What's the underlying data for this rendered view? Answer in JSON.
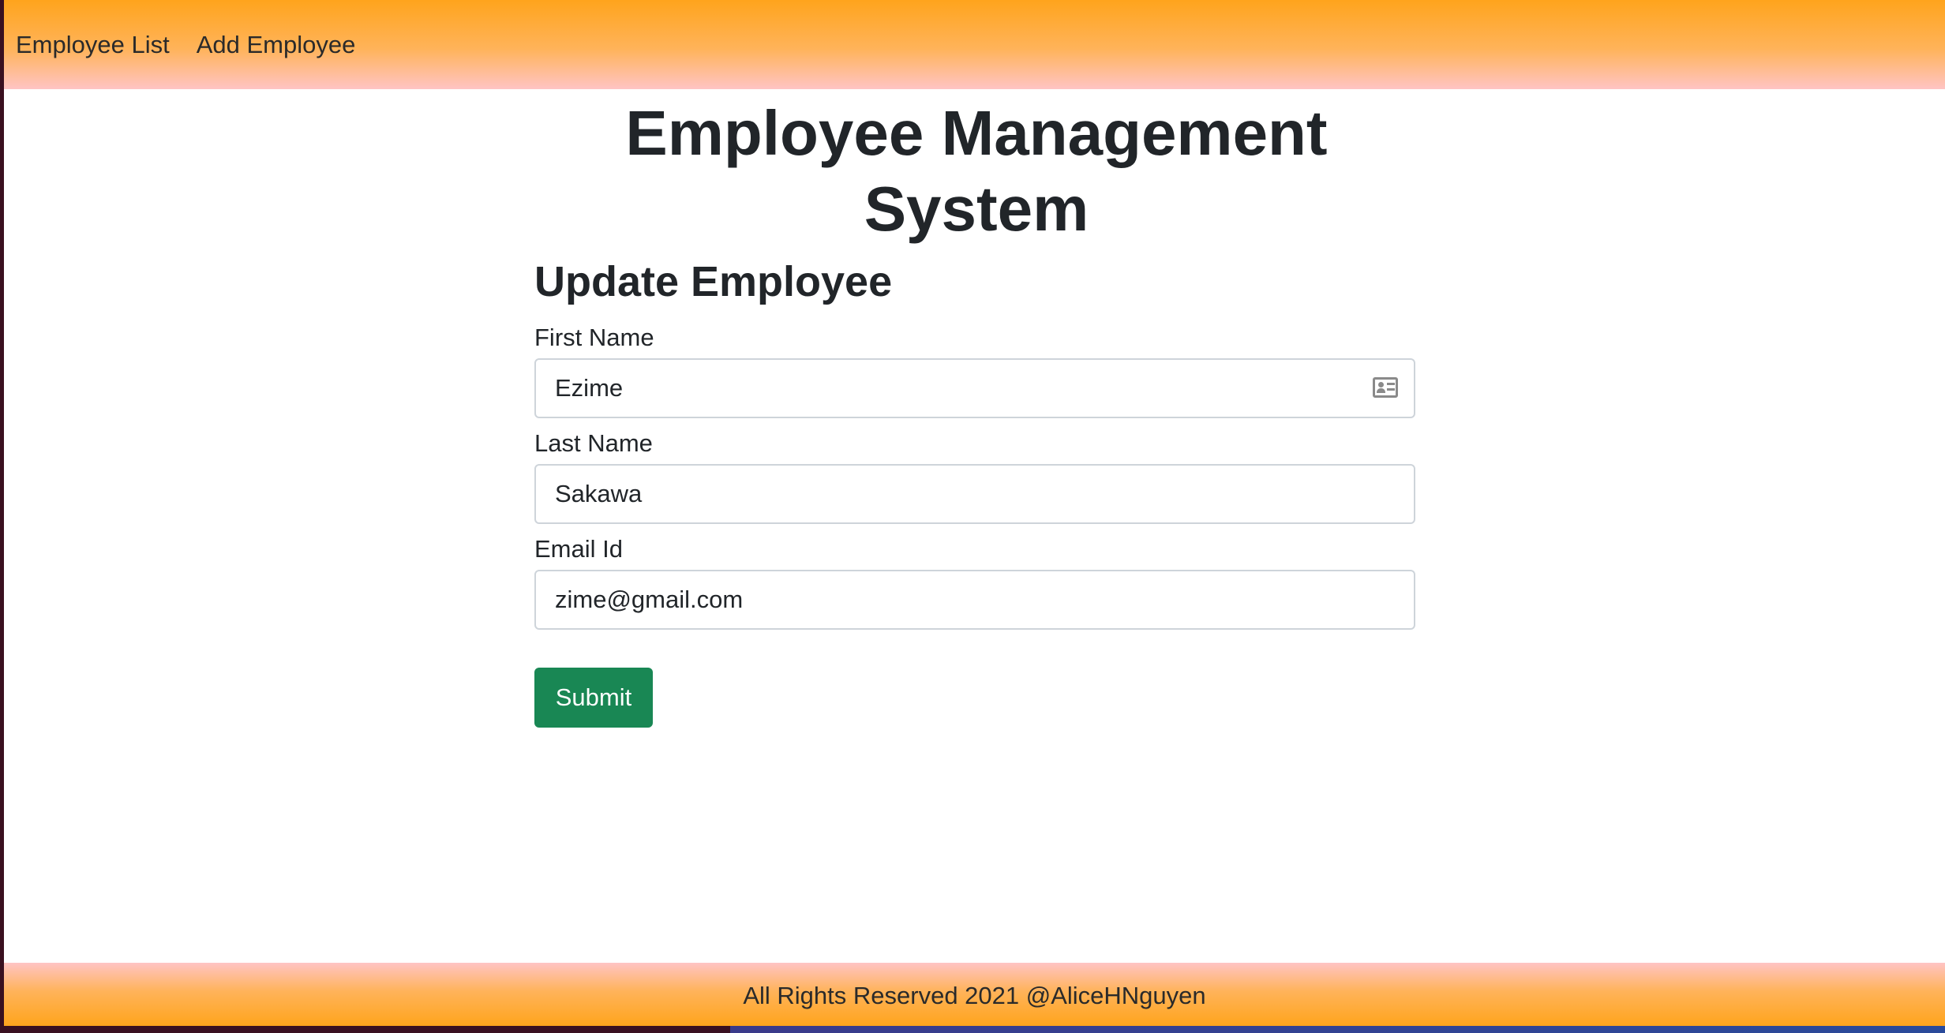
{
  "navbar": {
    "links": [
      {
        "label": "Employee List"
      },
      {
        "label": "Add Employee"
      }
    ]
  },
  "main": {
    "app_title": "Employee Management System",
    "form_title": "Update Employee",
    "fields": {
      "first_name": {
        "label": "First Name",
        "value": "Ezime",
        "icon": "contact-card-icon"
      },
      "last_name": {
        "label": "Last Name",
        "value": "Sakawa"
      },
      "email": {
        "label": "Email Id",
        "value": "zime@gmail.com"
      }
    },
    "submit_label": "Submit"
  },
  "footer": {
    "text": "All Rights Reserved 2021 @AliceHNguyen"
  },
  "colors": {
    "header_gradient_top": "#ffa41c",
    "header_gradient_bottom": "#ffc4c4",
    "submit_button": "#198754",
    "text": "#212529"
  }
}
